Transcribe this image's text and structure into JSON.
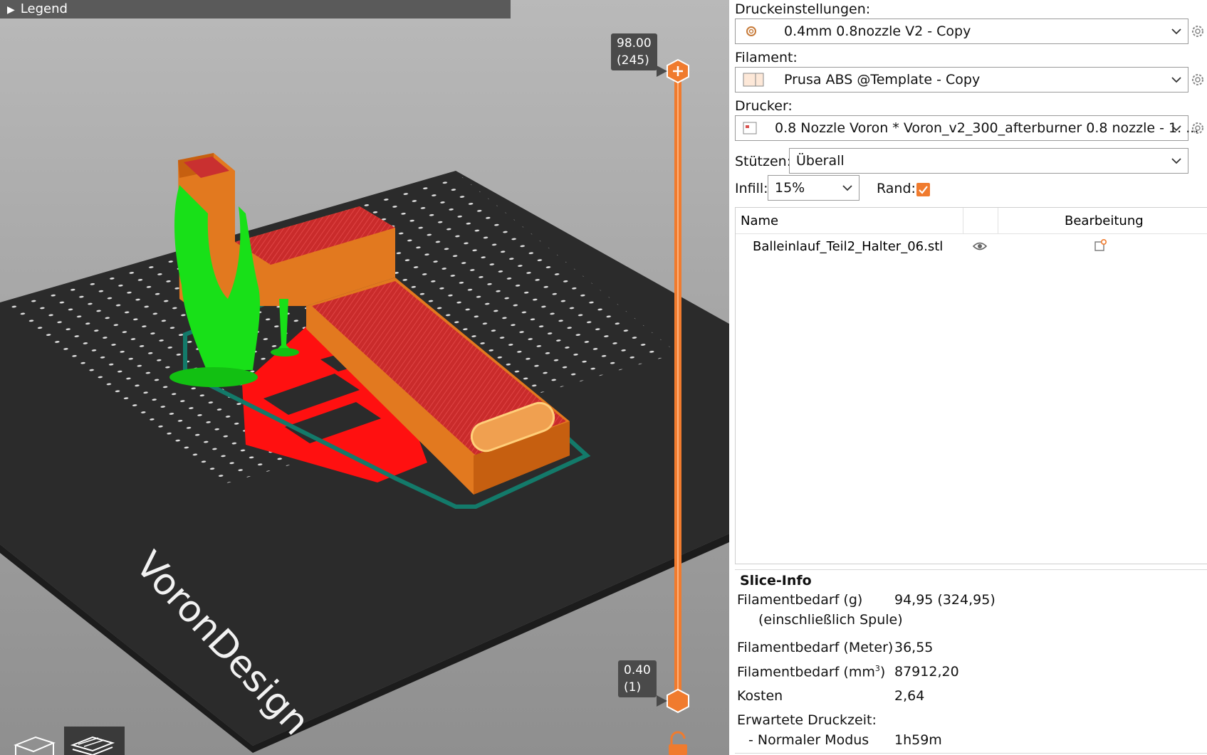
{
  "legend": {
    "label": "Legend"
  },
  "layer_slider": {
    "top_height": "98.00",
    "top_layer": "(245)",
    "bottom_height": "0.40",
    "bottom_layer": "(1)",
    "color": "#f07b2e"
  },
  "bed": {
    "logo_text": "VoronDesign"
  },
  "settings": {
    "print_label": "Druckeinstellungen:",
    "print_value": "0.4mm 0.8nozzle V2 - Copy",
    "filament_label": "Filament:",
    "filament_value": "Prusa ABS @Template - Copy",
    "printer_label": "Drucker:",
    "printer_value": "0.8 Nozzle Voron  * Voron_v2_300_afterburner 0.8 nozzle - 1. ...",
    "supports_label": "Stützen:",
    "supports_value": "Überall",
    "infill_label": "Infill:",
    "infill_value": "15%",
    "brim_label": "Rand:",
    "brim_checked": true
  },
  "object_list": {
    "col_name": "Name",
    "col_edit": "Bearbeitung",
    "items": [
      {
        "name": "Balleinlauf_Teil2_Halter_06.stl"
      }
    ]
  },
  "slice_info": {
    "title": "Slice-Info",
    "rows": [
      {
        "label": "Filamentbedarf (g)",
        "sublabel": "(einschließlich Spule)",
        "value": "94,95 (324,95)"
      },
      {
        "label": "Filamentbedarf (Meter)",
        "value": "36,55"
      },
      {
        "label": "Filamentbedarf (mm",
        "sup": "3",
        "label_end": ")",
        "value": "87912,20"
      },
      {
        "label": "Kosten",
        "value": "2,64"
      },
      {
        "label": "Erwartete Druckzeit:",
        "value": ""
      },
      {
        "label": "- Normaler Modus",
        "value": "1h59m"
      }
    ]
  },
  "colors": {
    "accent": "#f07b2e",
    "model": "#e2791f",
    "support": "#18e018",
    "infill": "#cc2a2a",
    "bed": "#2b2b2b"
  }
}
